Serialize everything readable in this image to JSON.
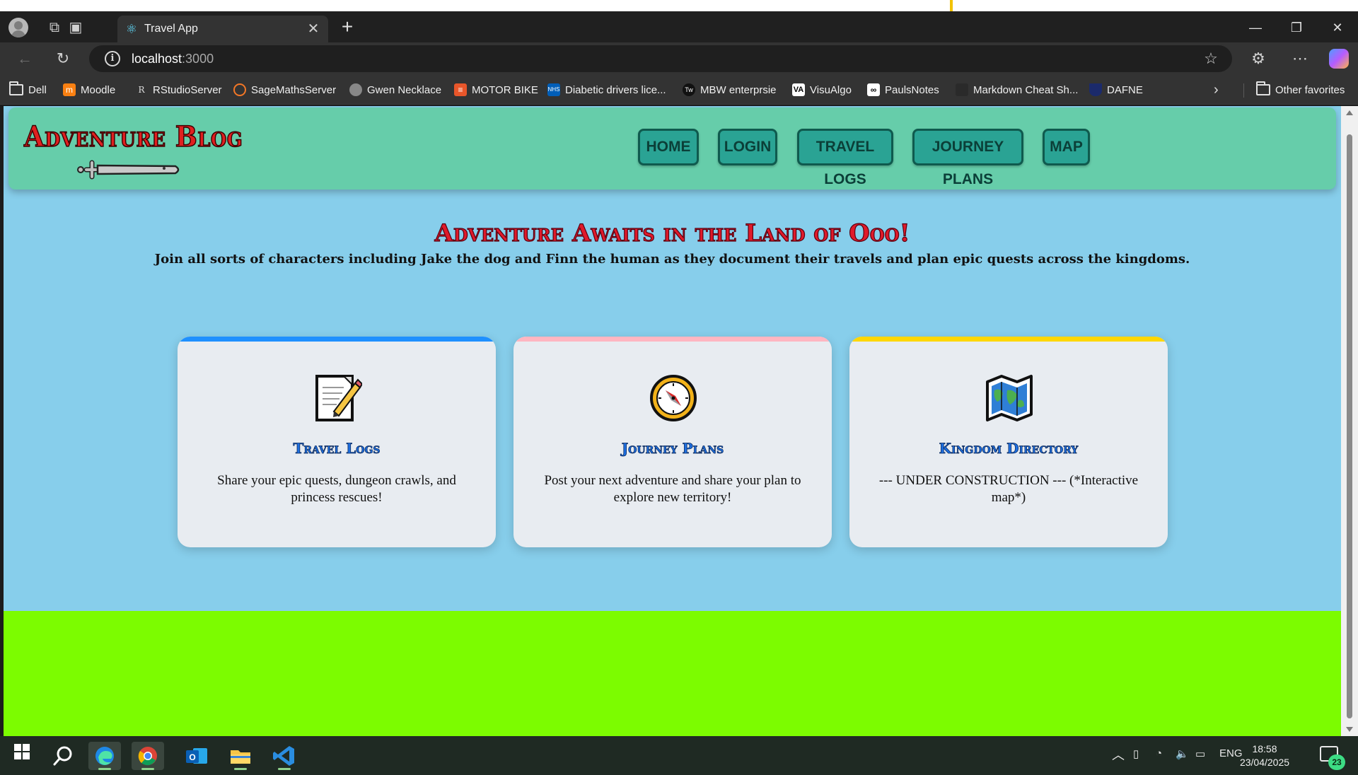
{
  "browser": {
    "tab_title": "Travel App",
    "url_host": "localhost",
    "url_port": ":3000",
    "bookmarks": [
      {
        "label": "Dell"
      },
      {
        "label": "Moodle"
      },
      {
        "label": "RStudioServer"
      },
      {
        "label": "SageMathsServer"
      },
      {
        "label": "Gwen Necklace"
      },
      {
        "label": "MOTOR BIKE"
      },
      {
        "label": "Diabetic drivers lice..."
      },
      {
        "label": "MBW enterprsie"
      },
      {
        "label": "VisuAlgo"
      },
      {
        "label": "PaulsNotes"
      },
      {
        "label": "Markdown Cheat Sh..."
      },
      {
        "label": "DAFNE"
      }
    ],
    "other_favorites": "Other favorites"
  },
  "site": {
    "logo": "Adventure Blog",
    "nav": [
      "HOME",
      "LOGIN",
      "TRAVEL LOGS",
      "JOURNEY PLANS",
      "MAP"
    ],
    "hero_title": "Adventure Awaits in the Land of Ooo!",
    "hero_subtitle": "Join all sorts of characters including Jake the dog and Finn the human as they document their travels and plan epic quests across the kingdoms.",
    "cards": [
      {
        "title": "Travel Logs",
        "desc": "Share your epic quests, dungeon crawls, and princess rescues!",
        "icon": "memo-icon",
        "accent": "#1e90ff"
      },
      {
        "title": "Journey Plans",
        "desc": "Post your next adventure and share your plan to explore new territory!",
        "icon": "compass-icon",
        "accent": "#ffb6c1"
      },
      {
        "title": "Kingdom Directory",
        "desc": "--- UNDER CONSTRUCTION --- (*Interactive map*)",
        "icon": "world-map-icon",
        "accent": "#ffd700"
      }
    ]
  },
  "taskbar": {
    "lang": "ENG",
    "time": "18:58",
    "date": "23/04/2025",
    "notifications": "23"
  },
  "colors": {
    "header_bg": "#66cdaa",
    "page_bg": "#87ceeb",
    "grass": "#7cfc00",
    "nav_btn": "#2aa394"
  }
}
